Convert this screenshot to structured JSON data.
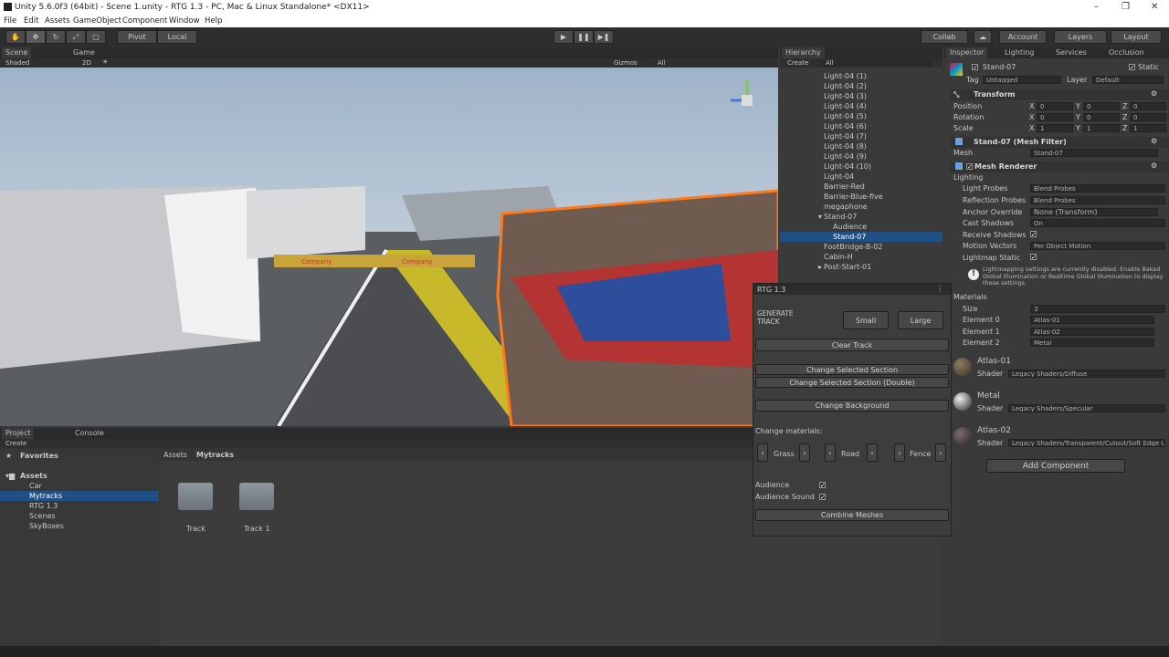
{
  "window": {
    "title": "Unity 5.6.0f3 (64bit) - Scene 1.unity - RTG 1.3 - PC, Mac & Linux Standalone* <DX11>"
  },
  "menu": [
    "File",
    "Edit",
    "Assets",
    "GameObject",
    "Component",
    "Window",
    "Help"
  ],
  "toolbar": {
    "pivot": "Pivot",
    "local": "Local",
    "collab": "Collab",
    "account": "Account",
    "layers": "Layers",
    "layout": "Layout"
  },
  "scene": {
    "tab_scene": "Scene",
    "tab_game": "Game",
    "shaded": "Shaded",
    "mode2d": "2D",
    "gizmos": "Gizmos",
    "search": "All",
    "sign1": "Company",
    "sign2": "Company"
  },
  "hierarchy": {
    "tab": "Hierarchy",
    "create": "Create",
    "search": "All",
    "items": [
      "Light-04 (1)",
      "Light-04 (2)",
      "Light-04 (3)",
      "Light-04 (4)",
      "Light-04 (5)",
      "Light-04 (6)",
      "Light-04 (7)",
      "Light-04 (8)",
      "Light-04 (9)",
      "Light-04 (10)",
      "Light-04",
      "Barrier-Red",
      "Barrier-Blue-five",
      "megaphone",
      "Stand-07",
      "Audience",
      "Stand-07",
      "FootBridge-B-02",
      "Cabin-H",
      "Post-Start-01"
    ]
  },
  "inspector": {
    "tabs": [
      "Inspector",
      "Lighting",
      "Services",
      "Occlusion"
    ],
    "object_name": "Stand-07",
    "static": "Static",
    "tag_label": "Tag",
    "tag_value": "Untagged",
    "layer_label": "Layer",
    "layer_value": "Default",
    "transform": {
      "title": "Transform",
      "position": "Position",
      "rotation": "Rotation",
      "scale": "Scale",
      "x": "X",
      "y": "Y",
      "z": "Z",
      "pos": [
        "0",
        "0",
        "0"
      ],
      "rot": [
        "0",
        "0",
        "0"
      ],
      "scl": [
        "1",
        "1",
        "1"
      ]
    },
    "mesh_filter": {
      "title": "Stand-07 (Mesh Filter)",
      "mesh_label": "Mesh",
      "mesh_value": "Stand-07"
    },
    "mesh_renderer": {
      "title": "Mesh Renderer",
      "lighting": "Lighting",
      "light_probes": "Light Probes",
      "light_probes_v": "Blend Probes",
      "reflection_probes": "Reflection Probes",
      "reflection_probes_v": "Blend Probes",
      "anchor_override": "Anchor Override",
      "anchor_override_v": "None (Transform)",
      "cast_shadows": "Cast Shadows",
      "cast_shadows_v": "On",
      "receive_shadows": "Receive Shadows",
      "motion_vectors": "Motion Vectors",
      "motion_vectors_v": "Per Object Motion",
      "lightmap_static": "Lightmap Static",
      "warning": "Lightmapping settings are currently disabled. Enable Baked Global Illumination or Realtime Global Illumination to display these settings.",
      "materials": "Materials",
      "size": "Size",
      "size_v": "3",
      "el0": "Element 0",
      "el0_v": "Atlas-01",
      "el1": "Element 1",
      "el1_v": "Atlas-02",
      "el2": "Element 2",
      "el2_v": "Metal"
    },
    "mats": [
      {
        "name": "Atlas-01",
        "shader_label": "Shader",
        "shader": "Legacy Shaders/Diffuse"
      },
      {
        "name": "Metal",
        "shader_label": "Shader",
        "shader": "Legacy Shaders/Specular"
      },
      {
        "name": "Atlas-02",
        "shader_label": "Shader",
        "shader": "Legacy Shaders/Transparent/Cutout/Soft Edge U"
      }
    ],
    "add_component": "Add Component"
  },
  "rtg": {
    "title": "RTG 1.3",
    "generate": "GENERATE TRACK",
    "small": "Small",
    "large": "Large",
    "clear": "Clear Track",
    "change_sel": "Change Selected Section",
    "change_sel_double": "Change Selected Section (Double)",
    "change_bg": "Change Background",
    "change_mat": "Change materials:",
    "grass": "Grass",
    "road": "Road",
    "fence": "Fence",
    "audience": "Audience",
    "audience_sound": "Audience Sound",
    "combine": "Combine Meshes"
  },
  "project": {
    "tab_project": "Project",
    "tab_console": "Console",
    "create": "Create",
    "favorites": "Favorites",
    "assets": "Assets",
    "tree": [
      "Car",
      "Mytracks",
      "RTG 1.3",
      "Scenes",
      "SkyBoxes"
    ],
    "breadcrumb1": "Assets",
    "breadcrumb2": "Mytracks",
    "files": [
      "Track",
      "Track 1"
    ]
  }
}
